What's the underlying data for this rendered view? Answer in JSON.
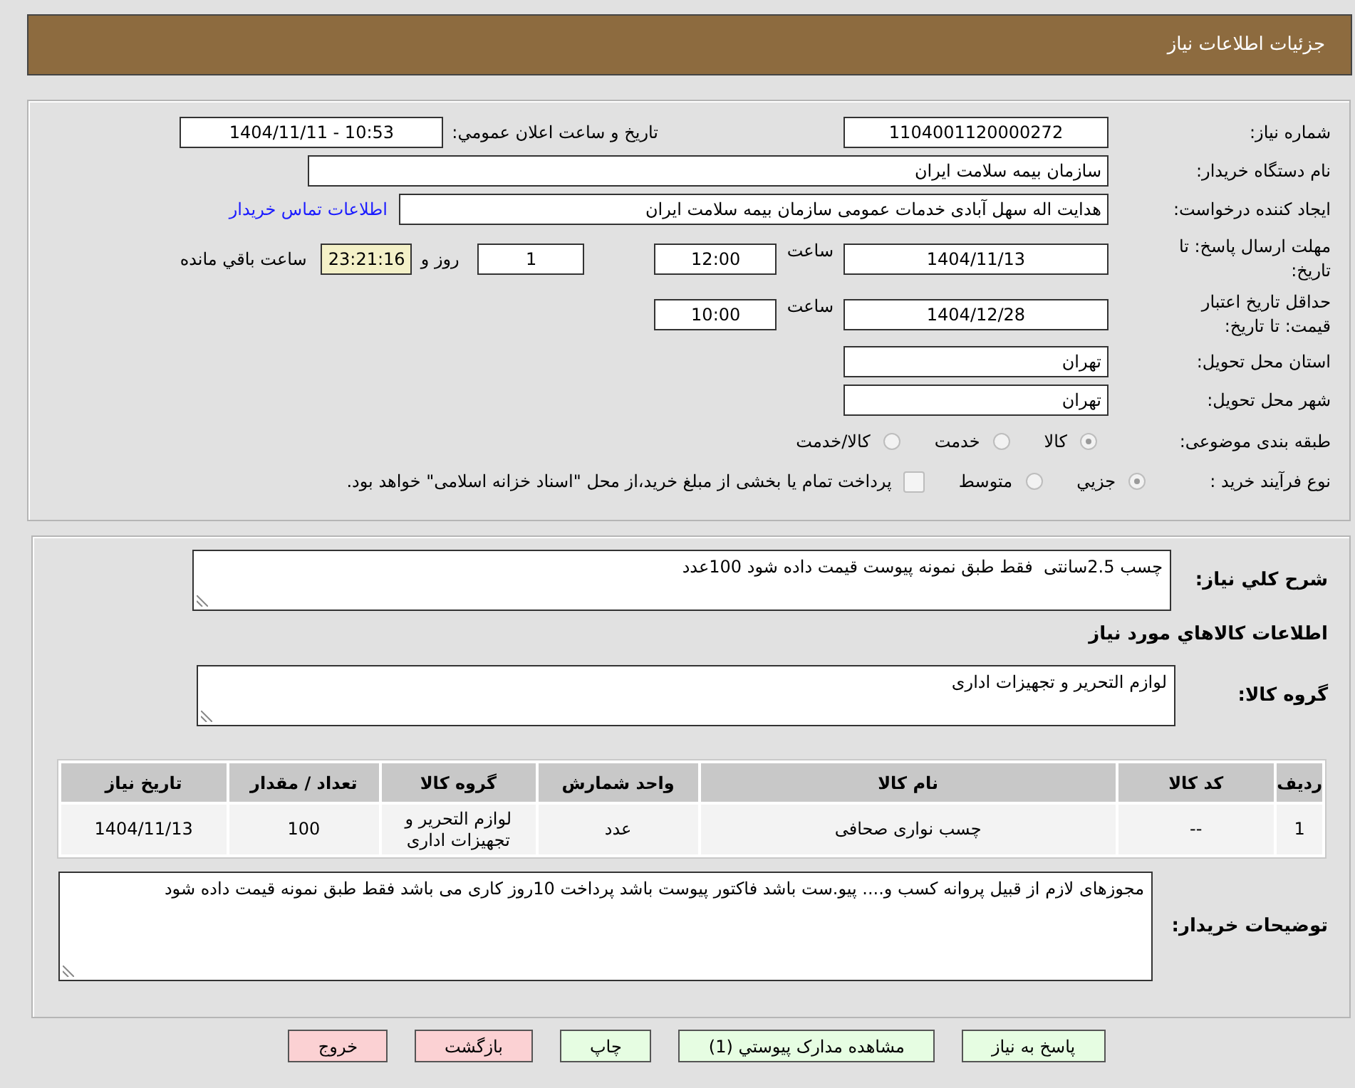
{
  "header": {
    "title": "جزئیات اطلاعات نیاز"
  },
  "details": {
    "need_number": {
      "label": "شماره نیاز:",
      "value": "1104001120000272"
    },
    "announce": {
      "label": "تاریخ و ساعت اعلان عمومي:",
      "value": "1404/11/11 - 10:53"
    },
    "buyer_org": {
      "label": "نام دستگاه خریدار:",
      "value": "سازمان بیمه سلامت ایران"
    },
    "requester": {
      "label": "ایجاد کننده درخواست:",
      "value": "هدایت اله سهل آبادی خدمات عمومی سازمان بیمه سلامت ایران",
      "link": "اطلاعات تماس خریدار"
    },
    "response_deadline": {
      "label": "مهلت ارسال پاسخ: تا تاریخ:",
      "date": "1404/11/13",
      "time_label": "ساعت",
      "time": "12:00",
      "days": "1",
      "days_label": "روز و",
      "remaining": "23:21:16",
      "remaining_label": "ساعت باقي مانده"
    },
    "price_validity": {
      "label": "حداقل تاریخ اعتبار قیمت: تا تاریخ:",
      "date": "1404/12/28",
      "time_label": "ساعت",
      "time": "10:00"
    },
    "province": {
      "label": "استان محل تحویل:",
      "value": "تهران"
    },
    "city": {
      "label": "شهر محل تحویل:",
      "value": "تهران"
    },
    "category": {
      "label": "طبقه بندی موضوعی:",
      "options": [
        {
          "label": "كالا",
          "selected": true
        },
        {
          "label": "خدمت",
          "selected": false
        },
        {
          "label": "كالا/خدمت",
          "selected": false
        }
      ]
    },
    "process": {
      "label": "نوع فرآیند خرید :",
      "options": [
        {
          "label": "جزيي",
          "selected": true
        },
        {
          "label": "متوسط",
          "selected": false
        }
      ],
      "treasury": {
        "label": "پرداخت تمام یا بخشی از مبلغ خرید،از محل \"اسناد خزانه اسلامی\" خواهد بود.",
        "checked": false
      }
    }
  },
  "needs": {
    "summary": {
      "label": "شرح كلي نياز:",
      "value": "چسب 2.5سانتی  فقط طبق نمونه پیوست قیمت داده شود 100عدد"
    },
    "goods_heading": "اطلاعات كالاهاي مورد نياز",
    "goods_group": {
      "label": "گروه كالا:",
      "value": "لوازم التحرير و تجهيزات اداری"
    },
    "table": {
      "columns": [
        "رديف",
        "كد كالا",
        "نام كالا",
        "واحد شمارش",
        "گروه كالا",
        "تعداد / مقدار",
        "تاريخ نياز"
      ],
      "rows": [
        [
          "1",
          "--",
          "چسب نواری صحافی",
          "عدد",
          "لوازم التحرير و تجهيزات اداری",
          "100",
          "1404/11/13"
        ]
      ]
    },
    "buyer_notes": {
      "label": "توضیحات خریدار:",
      "value": "مجوزهای لازم از قبیل پروانه کسب و.... پیو.ست باشد فاکتور پیوست باشد پرداخت 10روز کاری می باشد فقط طبق نمونه قیمت داده شود"
    }
  },
  "buttons": [
    {
      "label": "پاسخ به نیاز",
      "kind": "action"
    },
    {
      "label": "مشاهده مدارک پيوستي (1)",
      "kind": "action"
    },
    {
      "label": "چاپ",
      "kind": "action"
    },
    {
      "label": "بازگشت",
      "kind": "exit"
    },
    {
      "label": "خروج",
      "kind": "exit"
    }
  ]
}
